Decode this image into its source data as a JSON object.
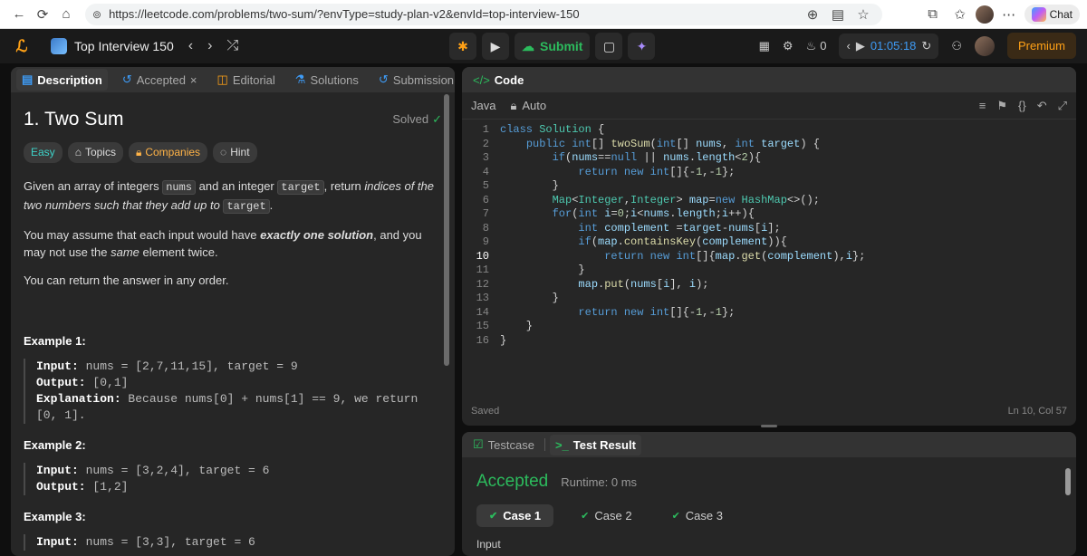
{
  "browser": {
    "url": "https://leetcode.com/problems/two-sum/?envType=study-plan-v2&envId=top-interview-150",
    "chat_label": "Chat"
  },
  "nav": {
    "plan_title": "Top Interview 150",
    "submit_label": "Submit",
    "streak_count": "0",
    "timer": "01:05:18",
    "premium_label": "Premium"
  },
  "left_tabs": [
    "Description",
    "Accepted",
    "Editorial",
    "Solutions",
    "Submission"
  ],
  "problem": {
    "title": "1. Two Sum",
    "status": "Solved",
    "tags": [
      "Easy",
      "Topics",
      "Companies",
      "Hint"
    ],
    "p1_a": "Given an array of integers ",
    "p1_code1": "nums",
    "p1_b": " and an integer ",
    "p1_code2": "target",
    "p1_c": ", return ",
    "p1_em": "indices of the two numbers such that they add up to",
    "p1_d": " ",
    "p1_code3": "target",
    "p1_e": ".",
    "p2_a": "You may assume that each input would have ",
    "p2_strong": "exactly one solution",
    "p2_b": ", and you may not use the ",
    "p2_em": "same",
    "p2_c": " element twice.",
    "p3": "You can return the answer in any order.",
    "examples": [
      {
        "title": "Example 1:",
        "input_label": "Input:",
        "input": " nums = [2,7,11,15], target = 9",
        "output_label": "Output:",
        "output": " [0,1]",
        "expl_label": "Explanation:",
        "expl": " Because nums[0] + nums[1] == 9, we return [0, 1]."
      },
      {
        "title": "Example 2:",
        "input_label": "Input:",
        "input": " nums = [3,2,4], target = 6",
        "output_label": "Output:",
        "output": " [1,2]"
      },
      {
        "title": "Example 3:",
        "input_label": "Input:",
        "input": " nums = [3,3], target = 6"
      }
    ]
  },
  "code_panel": {
    "title": "Code",
    "language": "Java",
    "mode": "Auto",
    "status_left": "Saved",
    "status_right": "Ln 10, Col 57",
    "current_line": 10,
    "lines": [
      [
        [
          "kw",
          "class "
        ],
        [
          "ty",
          "Solution"
        ],
        [
          "tx",
          " {"
        ]
      ],
      [
        [
          "tx",
          "    "
        ],
        [
          "kw",
          "public "
        ],
        [
          "kw",
          "int"
        ],
        [
          "tx",
          "[] "
        ],
        [
          "fn",
          "twoSum"
        ],
        [
          "tx",
          "("
        ],
        [
          "kw",
          "int"
        ],
        [
          "tx",
          "[] "
        ],
        [
          "vr",
          "nums"
        ],
        [
          "tx",
          ", "
        ],
        [
          "kw",
          "int "
        ],
        [
          "vr",
          "target"
        ],
        [
          "tx",
          ") {"
        ]
      ],
      [
        [
          "tx",
          "        "
        ],
        [
          "kw",
          "if"
        ],
        [
          "tx",
          "("
        ],
        [
          "vr",
          "nums"
        ],
        [
          "tx",
          "=="
        ],
        [
          "kw",
          "null"
        ],
        [
          "tx",
          " || "
        ],
        [
          "vr",
          "nums"
        ],
        [
          "tx",
          "."
        ],
        [
          "vr",
          "length"
        ],
        [
          "tx",
          "<"
        ],
        [
          "nm",
          "2"
        ],
        [
          "tx",
          "){"
        ]
      ],
      [
        [
          "tx",
          "            "
        ],
        [
          "kw",
          "return "
        ],
        [
          "kw",
          "new "
        ],
        [
          "kw",
          "int"
        ],
        [
          "tx",
          "[]{-"
        ],
        [
          "nm",
          "1"
        ],
        [
          "tx",
          ",-"
        ],
        [
          "nm",
          "1"
        ],
        [
          "tx",
          "};"
        ]
      ],
      [
        [
          "tx",
          "        }"
        ]
      ],
      [
        [
          "tx",
          "        "
        ],
        [
          "ty",
          "Map"
        ],
        [
          "tx",
          "<"
        ],
        [
          "ty",
          "Integer"
        ],
        [
          "tx",
          ","
        ],
        [
          "ty",
          "Integer"
        ],
        [
          "tx",
          "> "
        ],
        [
          "vr",
          "map"
        ],
        [
          "tx",
          "="
        ],
        [
          "kw",
          "new "
        ],
        [
          "ty",
          "HashMap"
        ],
        [
          "tx",
          "<>();"
        ]
      ],
      [
        [
          "tx",
          "        "
        ],
        [
          "kw",
          "for"
        ],
        [
          "tx",
          "("
        ],
        [
          "kw",
          "int "
        ],
        [
          "vr",
          "i"
        ],
        [
          "tx",
          "="
        ],
        [
          "nm",
          "0"
        ],
        [
          "tx",
          ";"
        ],
        [
          "vr",
          "i"
        ],
        [
          "tx",
          "<"
        ],
        [
          "vr",
          "nums"
        ],
        [
          "tx",
          "."
        ],
        [
          "vr",
          "length"
        ],
        [
          "tx",
          ";"
        ],
        [
          "vr",
          "i"
        ],
        [
          "tx",
          "++){"
        ]
      ],
      [
        [
          "tx",
          "            "
        ],
        [
          "kw",
          "int "
        ],
        [
          "vr",
          "complement"
        ],
        [
          "tx",
          " ="
        ],
        [
          "vr",
          "target"
        ],
        [
          "tx",
          "-"
        ],
        [
          "vr",
          "nums"
        ],
        [
          "tx",
          "["
        ],
        [
          "vr",
          "i"
        ],
        [
          "tx",
          "];"
        ]
      ],
      [
        [
          "tx",
          "            "
        ],
        [
          "kw",
          "if"
        ],
        [
          "tx",
          "("
        ],
        [
          "vr",
          "map"
        ],
        [
          "tx",
          "."
        ],
        [
          "fn",
          "containsKey"
        ],
        [
          "tx",
          "("
        ],
        [
          "vr",
          "complement"
        ],
        [
          "tx",
          ")){"
        ]
      ],
      [
        [
          "tx",
          "                "
        ],
        [
          "kw",
          "return "
        ],
        [
          "kw",
          "new "
        ],
        [
          "kw",
          "int"
        ],
        [
          "tx",
          "[]{"
        ],
        [
          "vr",
          "map"
        ],
        [
          "tx",
          "."
        ],
        [
          "fn",
          "get"
        ],
        [
          "tx",
          "("
        ],
        [
          "vr",
          "complement"
        ],
        [
          "tx",
          "),"
        ],
        [
          "vr",
          "i"
        ],
        [
          "tx",
          "};"
        ]
      ],
      [
        [
          "tx",
          "            }"
        ]
      ],
      [
        [
          "tx",
          "            "
        ],
        [
          "vr",
          "map"
        ],
        [
          "tx",
          "."
        ],
        [
          "fn",
          "put"
        ],
        [
          "tx",
          "("
        ],
        [
          "vr",
          "nums"
        ],
        [
          "tx",
          "["
        ],
        [
          "vr",
          "i"
        ],
        [
          "tx",
          "], "
        ],
        [
          "vr",
          "i"
        ],
        [
          "tx",
          ");"
        ]
      ],
      [
        [
          "tx",
          "        }"
        ]
      ],
      [
        [
          "tx",
          "            "
        ],
        [
          "kw",
          "return "
        ],
        [
          "kw",
          "new "
        ],
        [
          "kw",
          "int"
        ],
        [
          "tx",
          "[]{-"
        ],
        [
          "nm",
          "1"
        ],
        [
          "tx",
          ",-"
        ],
        [
          "nm",
          "1"
        ],
        [
          "tx",
          "};"
        ]
      ],
      [
        [
          "tx",
          "    }"
        ]
      ],
      [
        [
          "tx",
          "}"
        ]
      ]
    ]
  },
  "result_panel": {
    "tabs": [
      "Testcase",
      "Test Result"
    ],
    "verdict": "Accepted",
    "runtime": "Runtime: 0 ms",
    "cases": [
      "Case 1",
      "Case 2",
      "Case 3"
    ],
    "input_label": "Input"
  },
  "colors": {
    "accepted": "#2cbb5d",
    "brand": "#ffa116",
    "easy": "#3dd2c8"
  }
}
